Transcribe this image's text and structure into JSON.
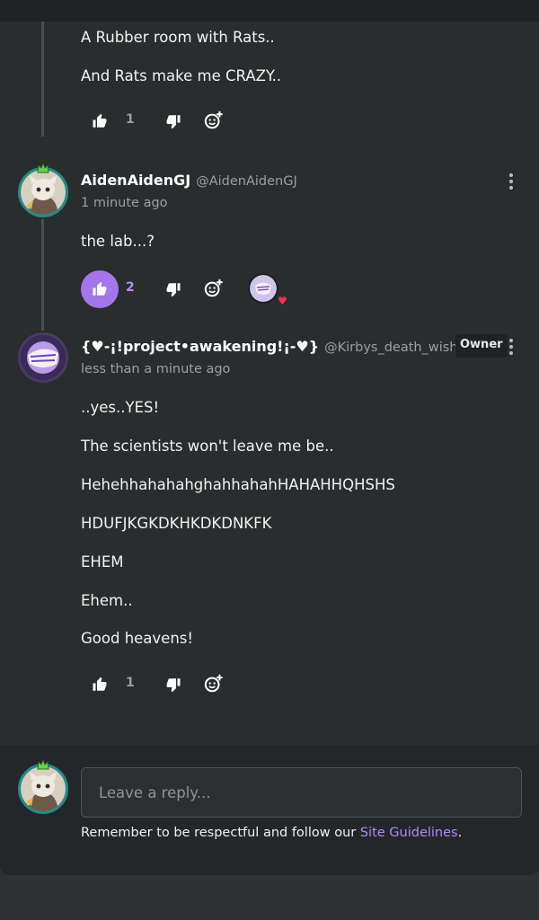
{
  "comments": [
    {
      "lines": [
        "A Rubber room with Rats..",
        "And Rats make me CRAZY.."
      ],
      "likes": "1"
    },
    {
      "name": "AidenAidenGJ",
      "handle": "@AidenAidenGJ",
      "time": "1 minute ago",
      "lines": [
        "the lab...?"
      ],
      "likes": "2",
      "liked": true,
      "reaction_badge": "heart"
    },
    {
      "name": "{♥-¡!project•awakening!¡-♥}",
      "handle": "@Kirbys_death_wish",
      "badge": "Owner",
      "time": "less than a minute ago",
      "lines": [
        "..yes..YES!",
        "The scientists won't leave me be..",
        "HehehhahahahghahhahahHAHAHHQHSHS",
        "HDUFJKGKDKHKDKDNKFK",
        "EHEM",
        "Ehem..",
        "Good heavens!"
      ],
      "likes": "1"
    }
  ],
  "reply": {
    "placeholder": "Leave a reply...",
    "note_prefix": "Remember to be respectful and follow our ",
    "note_link": "Site Guidelines",
    "note_suffix": "."
  },
  "icons": {
    "like": "thumbs-up-icon",
    "dislike": "thumbs-down-icon",
    "react": "add-reaction-icon",
    "menu": "more-vertical-icon"
  },
  "colors": {
    "accent": "#a575ec",
    "link": "#b286ff",
    "avatar_ring": "#1f8d8b"
  }
}
